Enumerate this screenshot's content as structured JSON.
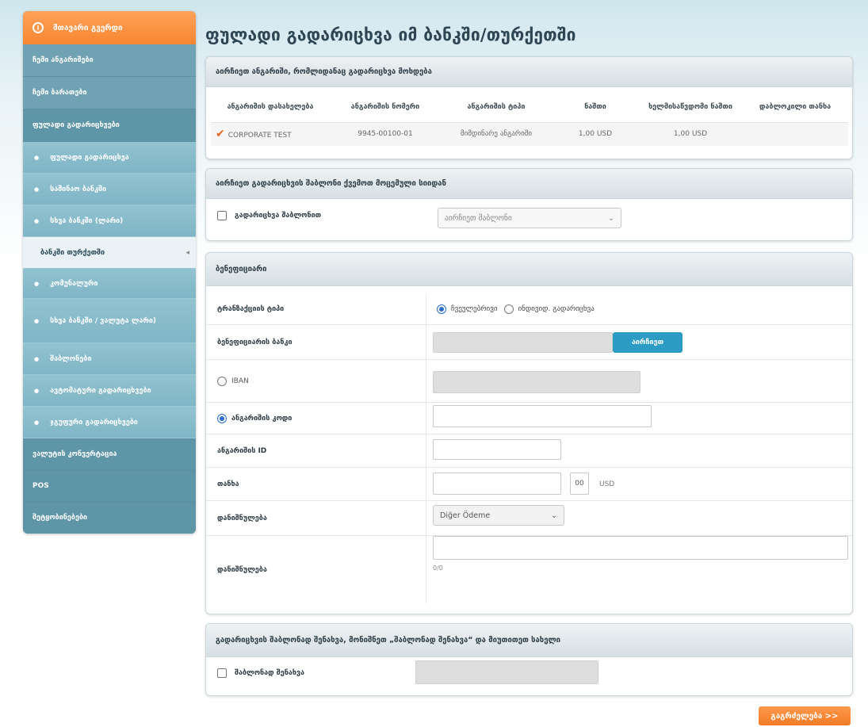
{
  "sidebar": {
    "header": "მთავარი გვერდი",
    "items_top": [
      "ჩემი ანგარიშები",
      "ჩემი ბარათები",
      "ფულადი გადარიცხვები"
    ],
    "subitems": [
      "ფულადი გადარიცხვა",
      "საშინაო ბანკში",
      "სხვა ბანკში (ლარი)",
      "ბანკში თურქეთში",
      "კომუნალური",
      "სხვა ბანკში / ვალუტა ლარი)",
      "შაბლონები",
      "ავტომატური გადარიცხვები",
      "ჯგუფური გადარიცხვები"
    ],
    "active_index": 3,
    "items_bottom": [
      "ვალუტის კონვერტაცია",
      "POS",
      "შეტყობინებები"
    ]
  },
  "page_title": "ფულადი გადარიცხვა იმ ბანკში/თურქეთში",
  "accounts_panel": {
    "title": "აირჩიეთ ანგარიში, რომლიდანაც გადარიცხვა მოხდება",
    "columns": [
      "ანგარიშის დასახელება",
      "ანგარიშის ნომერი",
      "ანგარიშის ტიპი",
      "ნაშთი",
      "ხელმისაწვდომი ნაშთი",
      "დაბლოკილი თანხა"
    ],
    "rows": [
      {
        "name": "CORPORATE TEST",
        "number": "9945-00100-01",
        "type": "მიმდინარე ანგარიში",
        "balance": "1,00 USD",
        "available": "1,00 USD",
        "blocked": ""
      }
    ]
  },
  "template_panel": {
    "title": "აირჩიეთ გადარიცხვის შაბლონი ქვემოთ მოცემული სიიდან",
    "checkbox_label": "გადარიცხვა შაბლონით",
    "select_value": "აირჩიეთ შაბლონი"
  },
  "beneficiary_panel": {
    "title": "ბენეფიციარი",
    "transfer_type_label": "ტრანზაქციის ტიპი",
    "transfer_type_options": [
      "ჩვეულებრივი",
      "ინდივიდ. გადარიცხვა"
    ],
    "bank_label": "ბენეფიციარის ბანკი",
    "choose_button": "აირჩიეთ",
    "iban_label": "IBAN",
    "account_label": "ანგარიშის კოდი",
    "account_id_label": "ანგარიშის ID",
    "amount_label": "თანხა",
    "amount_cents": "00",
    "currency": "USD",
    "purpose_label": "დანიშნულება",
    "purpose_value": "Diğer Ödeme",
    "comment_label": "დანიშნულება",
    "char_count": "0/0"
  },
  "save_panel": {
    "title": "გადარიცხვის შაბლონად შენახვა, მონიშნეთ „შაბლონად შენახვა“ და მიუთითეთ სახელი",
    "checkbox_label": "შაბლონად შენახვა"
  },
  "next_button": "გაგრძელება >>"
}
